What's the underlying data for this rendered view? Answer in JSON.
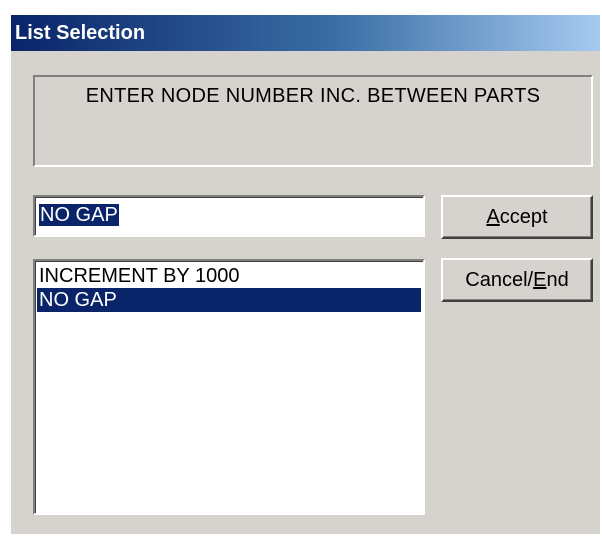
{
  "window": {
    "title": "List Selection"
  },
  "prompt": {
    "text": "ENTER NODE NUMBER INC. BETWEEN PARTS"
  },
  "input": {
    "value": "NO GAP"
  },
  "buttons": {
    "accept_pre": "",
    "accept_key": "A",
    "accept_post": "ccept",
    "cancel_pre": "Cancel/",
    "cancel_key": "E",
    "cancel_post": "nd"
  },
  "list": {
    "items": [
      {
        "label": "INCREMENT BY 1000",
        "selected": false
      },
      {
        "label": "NO GAP",
        "selected": true
      }
    ]
  },
  "colors": {
    "selection": "#0a246a",
    "dialog_bg": "#d6d3ce",
    "title_gradient_start": "#0a246a",
    "title_gradient_end": "#a6caf0"
  }
}
